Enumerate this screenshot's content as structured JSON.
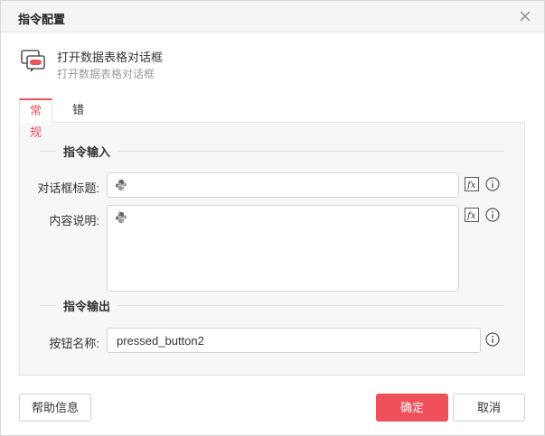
{
  "dialog": {
    "title": "指令配置"
  },
  "command": {
    "name": "打开数据表格对话框",
    "description": "打开数据表格对话框",
    "icon": "dialog-chat-icon"
  },
  "tabs": [
    {
      "label": "常规",
      "active": true
    },
    {
      "label": "错误处理",
      "active": false
    }
  ],
  "sections": {
    "input_title": "指令输入",
    "output_title": "指令输出"
  },
  "fields": {
    "dialog_title": {
      "label": "对话框标题:",
      "value": ""
    },
    "content_desc": {
      "label": "内容说明:",
      "value": ""
    },
    "button_name": {
      "label": "按钮名称:",
      "value": "pressed_button2"
    }
  },
  "buttons": {
    "help": "帮助信息",
    "ok": "确定",
    "cancel": "取消"
  },
  "colors": {
    "accent": "#f0505a",
    "panel_bg": "#f7f7f7",
    "titlebar_bg": "#f5f5f5"
  }
}
